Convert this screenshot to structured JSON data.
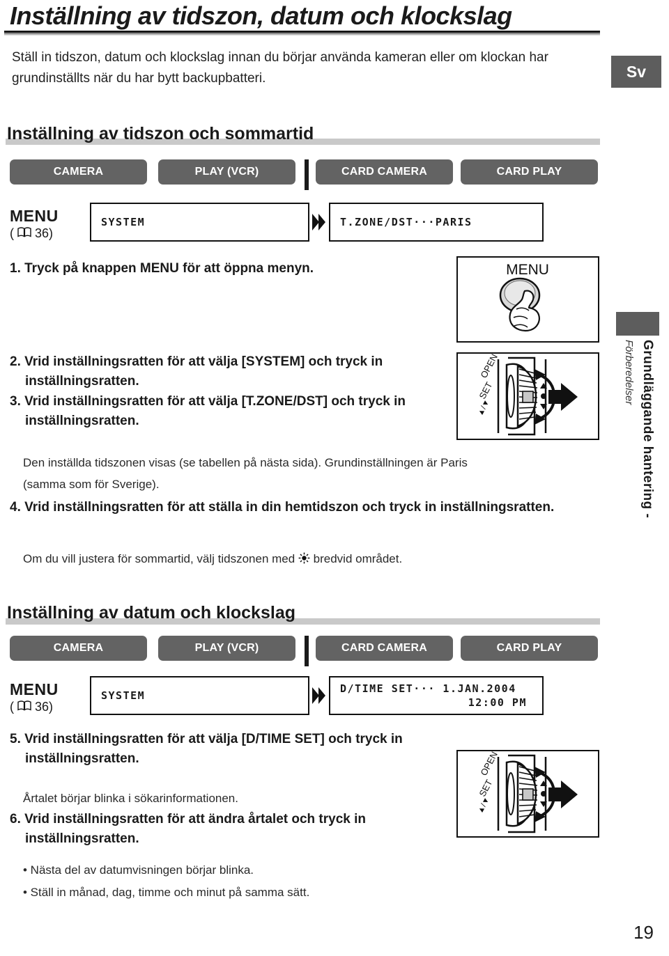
{
  "document": {
    "title": "Inställning av tidszon, datum och klockslag",
    "intro": "Ställ in tidszon, datum och klockslag innan du börjar använda kameran eller om klockan har grundinställts när du har bytt backupbatteri.",
    "language_badge": "Sv",
    "page_number": "19"
  },
  "side_tab": {
    "bold_text": "Grundläggande hantering -",
    "italic_text": "Förberedelser"
  },
  "mode_tabs": [
    "CAMERA",
    "PLAY (VCR)",
    "CARD CAMERA",
    "CARD PLAY"
  ],
  "section1": {
    "heading": "Inställning av tidszon och sommartid",
    "menu_label": "MENU",
    "menu_page_ref": "36)",
    "menu_page_open": "(",
    "lcd_left": "SYSTEM",
    "lcd_right": "T.ZONE/DST···PARIS",
    "steps": [
      {
        "text": "1. Tryck på knappen MENU för att öppna menyn."
      },
      {
        "text": "2. Vrid inställningsratten för att välja [SYSTEM] och tryck in inställningsratten."
      },
      {
        "text": "3. Vrid inställningsratten för att välja [T.ZONE/DST] och tryck in inställningsratten."
      }
    ],
    "note_after_3_line1": "Den inställda tidszonen visas (se tabellen på nästa sida). Grundinställningen är Paris",
    "note_after_3_line2": "(samma som för Sverige).",
    "step4": "4. Vrid inställningsratten för att ställa in din hemtidszon och tryck in inställningsratten.",
    "note_after_4_a": "Om du vill justera för sommartid, välj tidszonen med ",
    "note_after_4_b": " bredvid området."
  },
  "section2": {
    "heading": "Inställning av datum och klockslag",
    "menu_label": "MENU",
    "menu_page_ref": "36)",
    "menu_page_open": "(",
    "lcd_left": "SYSTEM",
    "lcd_right_line1": "D/TIME SET··· 1.JAN.2004",
    "lcd_right_line2": "12:00 PM",
    "step5": "5. Vrid inställningsratten för att välja [D/TIME SET] och tryck in inställningsratten.",
    "note_after_5": "Årtalet börjar blinka i sökarinformationen.",
    "step6": "6. Vrid inställningsratten för att ändra årtalet och tryck in inställningsratten.",
    "bullets": [
      "• Nästa del av datumvisningen börjar blinka.",
      "• Ställ in månad, dag, timme och minut på samma sätt."
    ]
  },
  "illustrations": {
    "menu_button_label": "MENU",
    "dial_labels": [
      "OPEN",
      "SET",
      "▲/▼"
    ]
  },
  "colors": {
    "pill_bg": "#636363",
    "badge_bg": "#5d5d5d",
    "section_bar": "#c9c9c9"
  }
}
